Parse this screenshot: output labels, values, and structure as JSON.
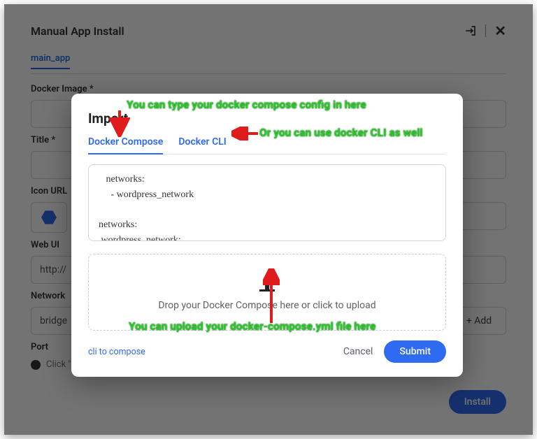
{
  "background": {
    "title": "Manual App Install",
    "file_tab": "main_app",
    "labels": {
      "docker_image": "Docker Image *",
      "title": "Title *",
      "icon_url": "Icon URL",
      "web_ui": "Web UI",
      "network": "Network",
      "port": "Port"
    },
    "webui_value": "http://",
    "network_value": "bridge",
    "add_button": "+  Add",
    "port_hint": "Click \"+\" to add one.",
    "install_button": "Install"
  },
  "import_dialog": {
    "title": "Import",
    "tabs": {
      "compose": "Docker Compose",
      "cli": "Docker CLI"
    },
    "code": "   networks:\n     - wordpress_network\n\nnetworks:\n wordpress_network:",
    "drop_text": "Drop your Docker Compose here or click to upload",
    "cli_link": "cli to compose",
    "cancel": "Cancel",
    "submit": "Submit"
  },
  "annotations": {
    "a1": "You can type your docker compose config in here",
    "a2": "Or you can use docker CLI as well",
    "a3": "You can upload your docker-compose.yml file here"
  }
}
